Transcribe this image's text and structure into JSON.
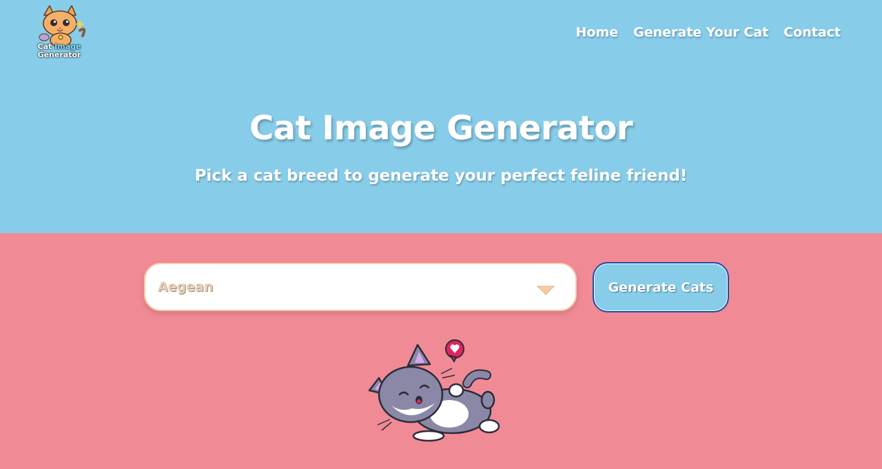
{
  "logo": {
    "line1_a": "Cat",
    "line1_b": "Image",
    "line2": "Generator"
  },
  "nav": {
    "items": [
      "Home",
      "Generate Your Cat",
      "Contact"
    ]
  },
  "hero": {
    "title": "Cat Image Generator",
    "subtitle": "Pick a cat breed to generate your perfect feline friend!"
  },
  "controls": {
    "breed_select": {
      "value": "Aegean",
      "icon": "chevron-down-icon"
    },
    "generate_label": "Generate Cats"
  },
  "colors": {
    "hero_bg": "#87CCE9",
    "body_bg": "#F08A95",
    "select_border": "#F6CDA8",
    "button_border": "#1B4FA8"
  }
}
